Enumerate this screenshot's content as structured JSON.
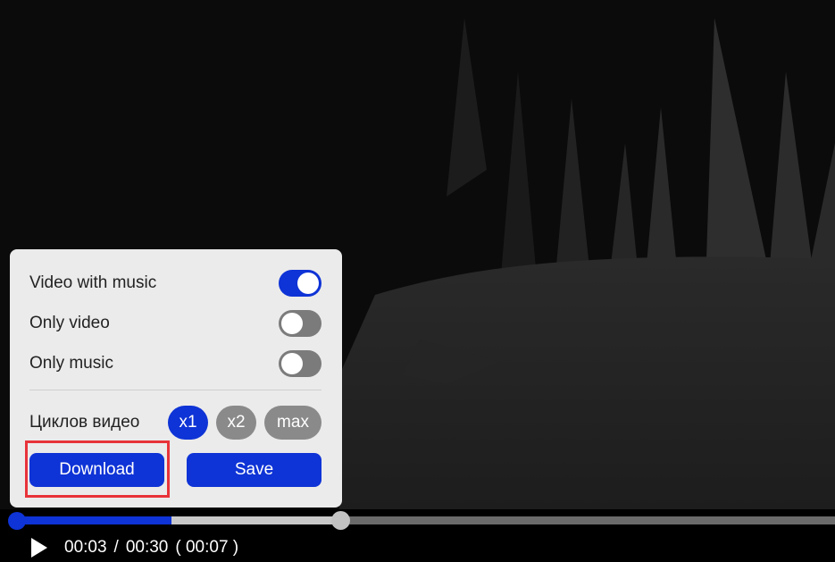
{
  "options": [
    {
      "label": "Video with music",
      "enabled": true
    },
    {
      "label": "Only video",
      "enabled": false
    },
    {
      "label": "Only music",
      "enabled": false
    }
  ],
  "cycles": {
    "label": "Циклов видео",
    "choices": [
      "x1",
      "x2",
      "max"
    ],
    "selected": "x1"
  },
  "buttons": {
    "download": "Download",
    "save": "Save"
  },
  "player": {
    "current_time": "00:03",
    "separator": "/",
    "duration": "00:30",
    "clip_length": "( 00:07 )",
    "played_fraction": 0.19,
    "selection_end_fraction": 0.39
  },
  "colors": {
    "accent": "#0e33d6",
    "highlight": "#e8333a"
  },
  "icons": {
    "play": "play-icon"
  }
}
